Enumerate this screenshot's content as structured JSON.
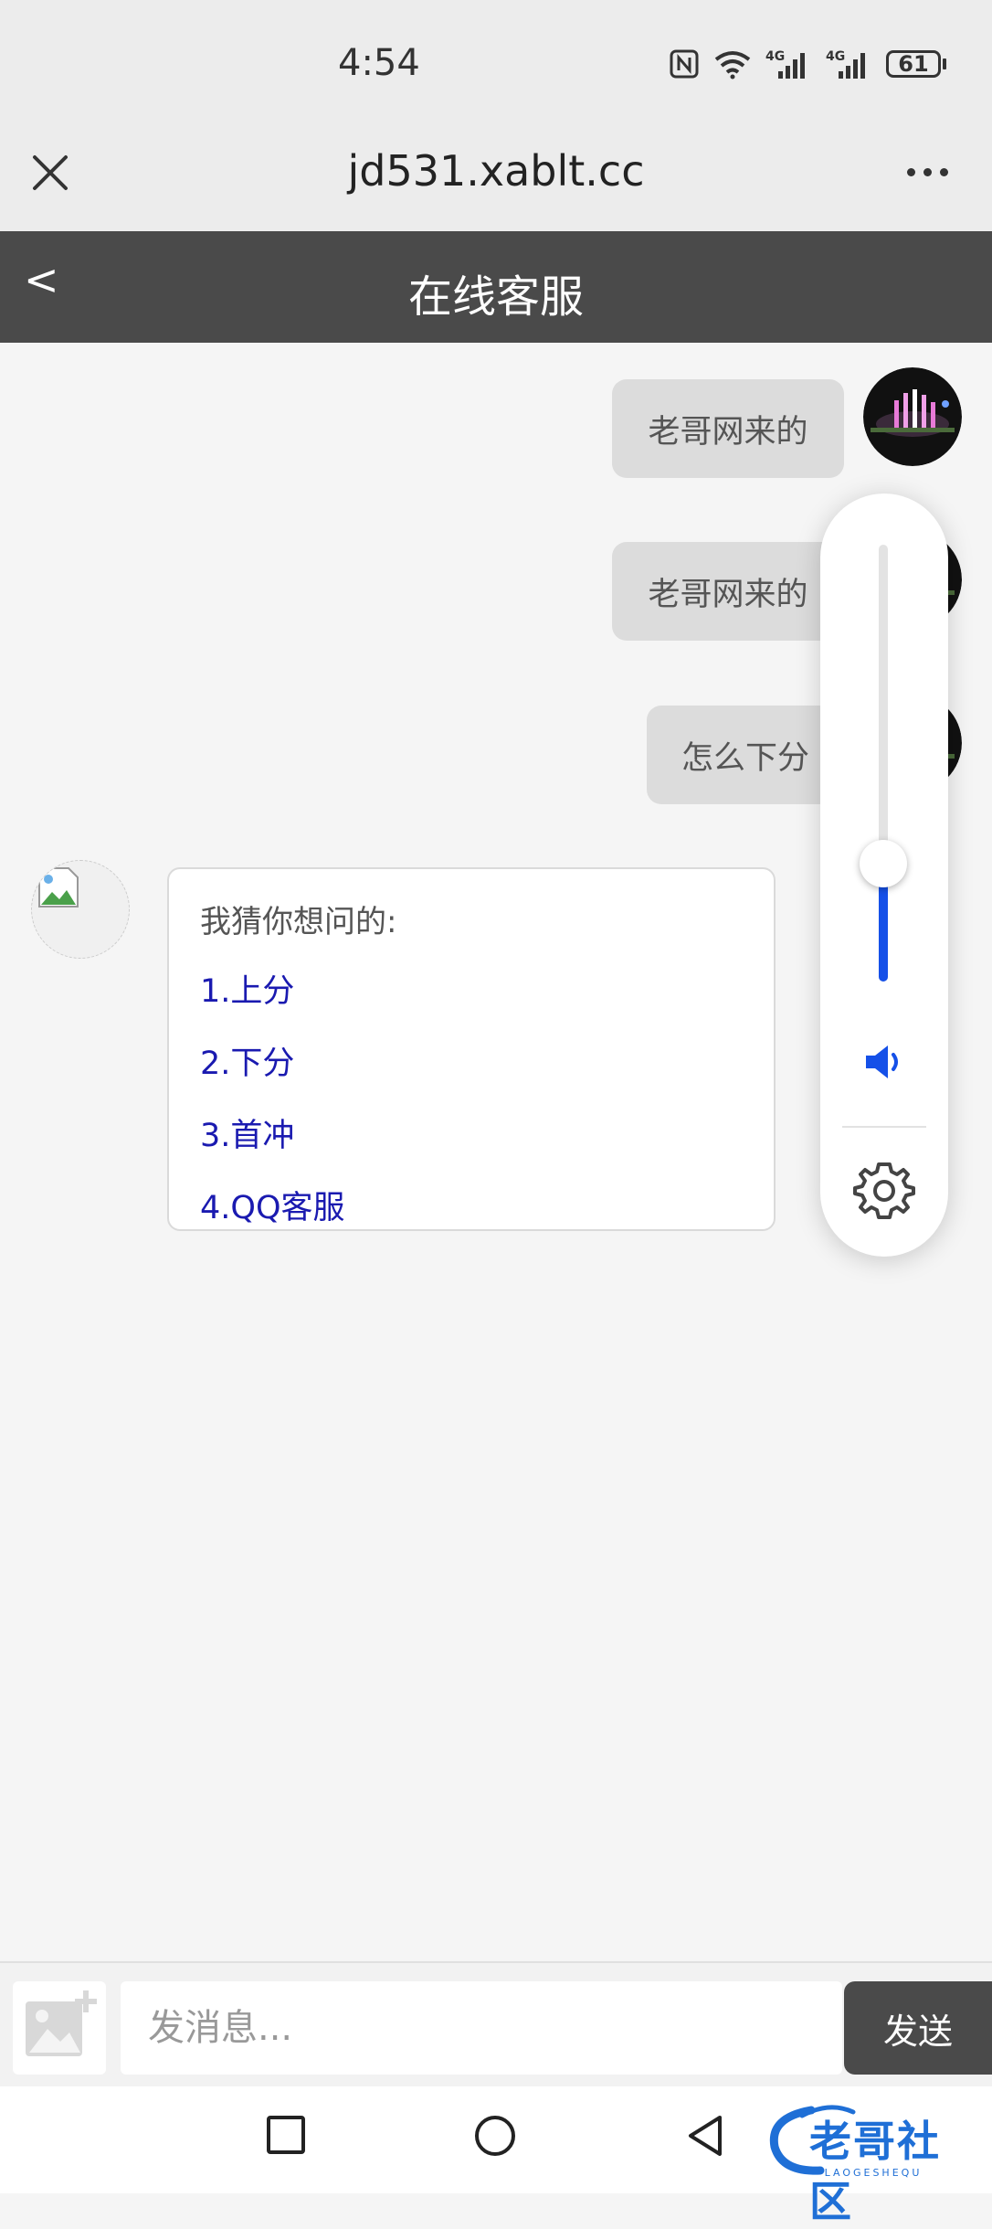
{
  "status_bar": {
    "time": "4:54",
    "battery": "61",
    "icons": [
      "nfc-icon",
      "wifi-icon",
      "signal-4g-icon",
      "signal-4g-icon"
    ]
  },
  "browser": {
    "url": "jd531.xablt.cc",
    "close_icon": "close-icon",
    "more_icon": "more-horizontal-icon"
  },
  "header": {
    "back_label": "<",
    "title": "在线客服"
  },
  "messages": {
    "sent": [
      "老哥网来的",
      "老哥网来的",
      "怎么下分"
    ],
    "reply": {
      "intro": "我猜你想问的:",
      "options": [
        "1.上分",
        "2.下分",
        "3.首冲",
        "4.QQ客服"
      ]
    }
  },
  "volume_panel": {
    "level": 0.27,
    "speaker_icon": "speaker-icon",
    "settings_icon": "gear-icon"
  },
  "composer": {
    "placeholder": "发消息...",
    "send_label": "发送",
    "image_icon": "add-image-icon"
  },
  "nav": {
    "buttons": [
      "recents-square-icon",
      "home-circle-icon",
      "back-triangle-icon"
    ]
  },
  "watermark": {
    "text": "老哥社区",
    "sub": "LAOGESHEQU"
  },
  "colors": {
    "header_bg": "#4a4a4a",
    "link": "#1a1ab0",
    "volume_accent": "#1550e8"
  }
}
